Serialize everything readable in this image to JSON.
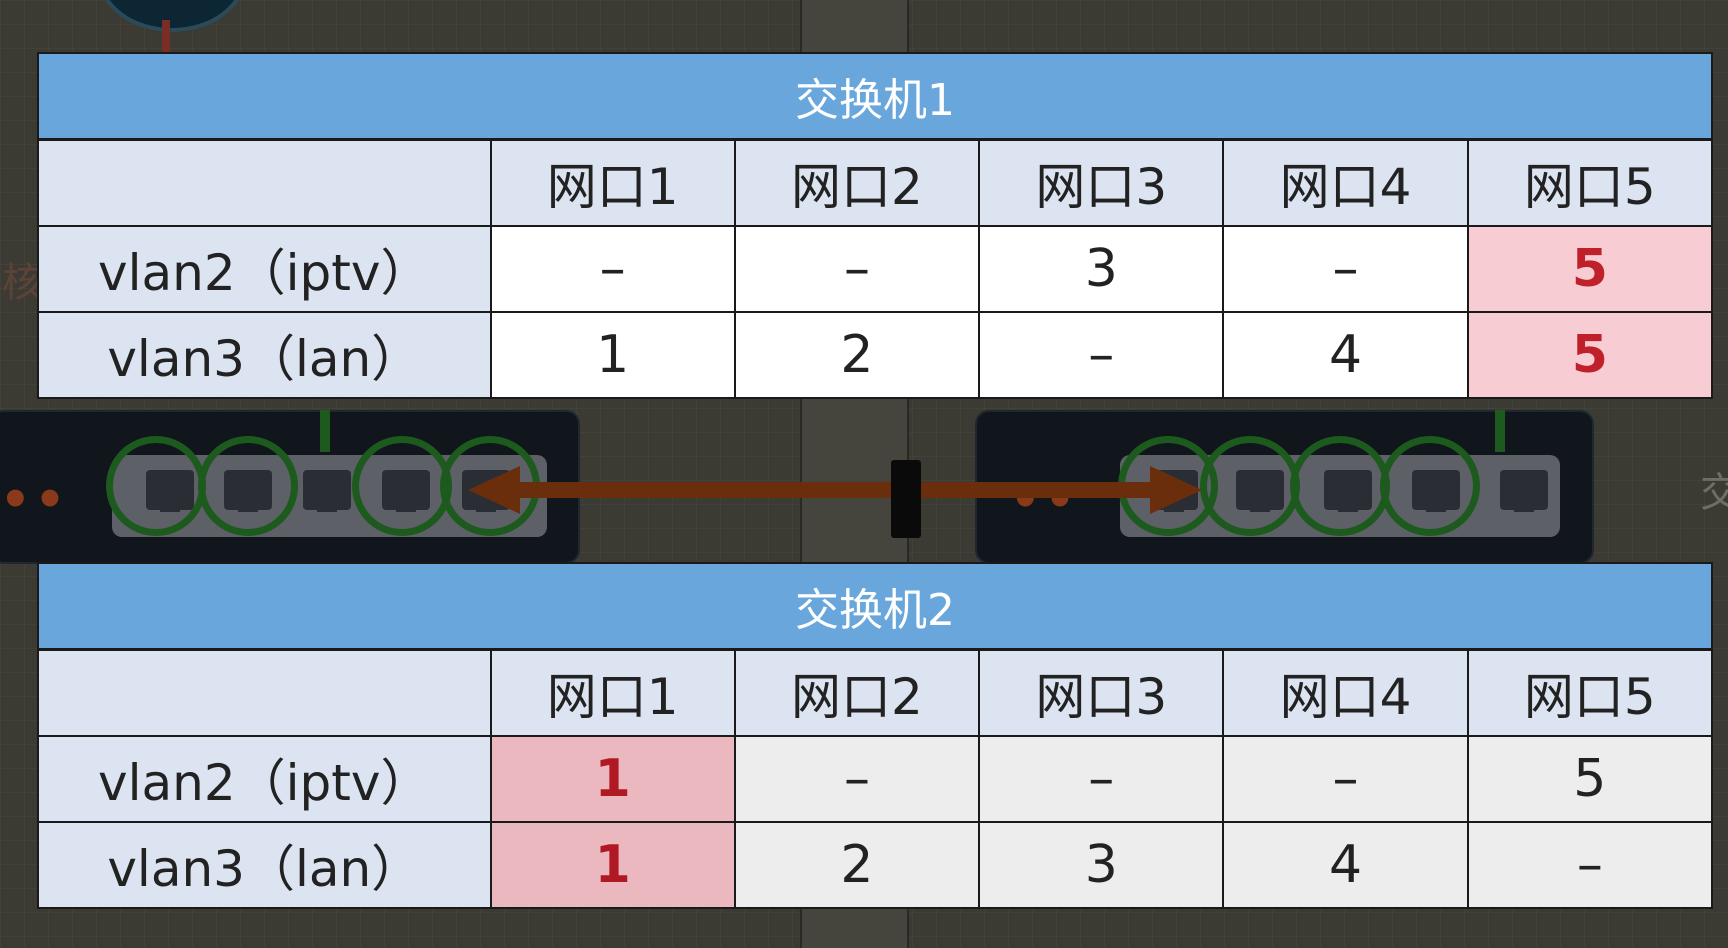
{
  "background": {
    "ghost_left_char": "核",
    "ghost_right_char": "交"
  },
  "switch1": {
    "title": "交换机1",
    "ports": [
      "网口1",
      "网口2",
      "网口3",
      "网口4",
      "网口5"
    ],
    "rows": [
      {
        "label": "vlan2（iptv）",
        "cells": [
          "–",
          "–",
          "3",
          "–",
          "5"
        ],
        "highlight": [
          false,
          false,
          false,
          false,
          true
        ]
      },
      {
        "label": "vlan3（lan）",
        "cells": [
          "1",
          "2",
          "–",
          "4",
          "5"
        ],
        "highlight": [
          false,
          false,
          false,
          false,
          true
        ]
      }
    ]
  },
  "switch2": {
    "title": "交换机2",
    "ports": [
      "网口1",
      "网口2",
      "网口3",
      "网口4",
      "网口5"
    ],
    "rows": [
      {
        "label": "vlan2（iptv）",
        "cells": [
          "1",
          "–",
          "–",
          "–",
          "5"
        ],
        "highlight": [
          true,
          false,
          false,
          false,
          false
        ]
      },
      {
        "label": "vlan3（lan）",
        "cells": [
          "1",
          "2",
          "3",
          "4",
          "–"
        ],
        "highlight": [
          true,
          false,
          false,
          false,
          false
        ]
      }
    ]
  },
  "colors": {
    "title_bar": "#68a6db",
    "header_bg": "#dce4f2",
    "highlight_bg": "#f7cdd3",
    "highlight_text": "#c0202a",
    "link_arrow": "#6a2e0c",
    "port_ring": "#1d5a1d"
  }
}
